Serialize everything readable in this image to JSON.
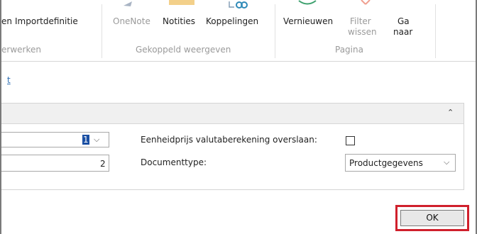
{
  "ribbon": {
    "groups": [
      {
        "label": "erwerken",
        "buttons": [
          {
            "label": "en"
          },
          {
            "label": "Importdefinitie"
          }
        ]
      },
      {
        "label": "Gekoppeld weergeven",
        "buttons": [
          {
            "label": "OneNote"
          },
          {
            "label": "Notities"
          },
          {
            "label": "Koppelingen"
          }
        ]
      },
      {
        "label": "Pagina",
        "buttons": [
          {
            "label": "Vernieuwen"
          },
          {
            "label": "Filter",
            "label2": "wissen"
          },
          {
            "label": "Ga",
            "label2": "naar"
          }
        ]
      }
    ]
  },
  "link_fragment": "t",
  "section": {
    "fields": {
      "first_value": "1",
      "second_value": "2",
      "exchange_label": "Eenheidprijs valutaberekening overslaan:",
      "doctype_label": "Documenttype:",
      "doctype_value": "Productgegevens"
    }
  },
  "ok_label": "OK",
  "colors": {
    "highlight": "#d0202c",
    "accent": "#2e6fb3"
  }
}
